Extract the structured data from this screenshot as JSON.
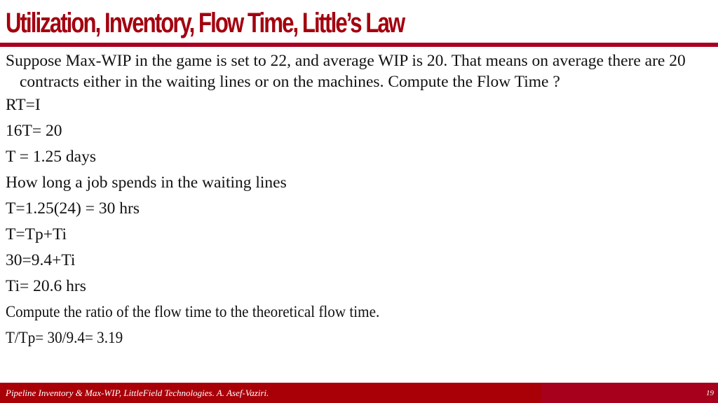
{
  "slide": {
    "title": "Utilization, Inventory, Flow Time, Little’s Law",
    "question": "Suppose Max-WIP in the game is set to 22, and average WIP is 20. That means on average there are 20 contracts either in the waiting lines or on the machines. Compute the Flow Time ?",
    "lines": [
      "RT=I",
      "16T= 20",
      "T = 1.25 days",
      "How long a job spends in the waiting lines",
      "T=1.25(24) = 30 hrs",
      "T=Tp+Ti",
      "30=9.4+Ti",
      "Ti= 20.6 hrs",
      "Compute the ratio of the flow time to the theoretical flow time.",
      "T/Tp= 30/9.4= 3.19"
    ]
  },
  "footer": {
    "text": "Pipeline Inventory & Max-WIP, LittleField Technologies. A. Asef-Vaziri.",
    "page_number": "19"
  },
  "colors": {
    "title": "#a3000f",
    "rule": "#a8001e",
    "footer_left": "#a90008",
    "footer_right": "#a6001c"
  }
}
